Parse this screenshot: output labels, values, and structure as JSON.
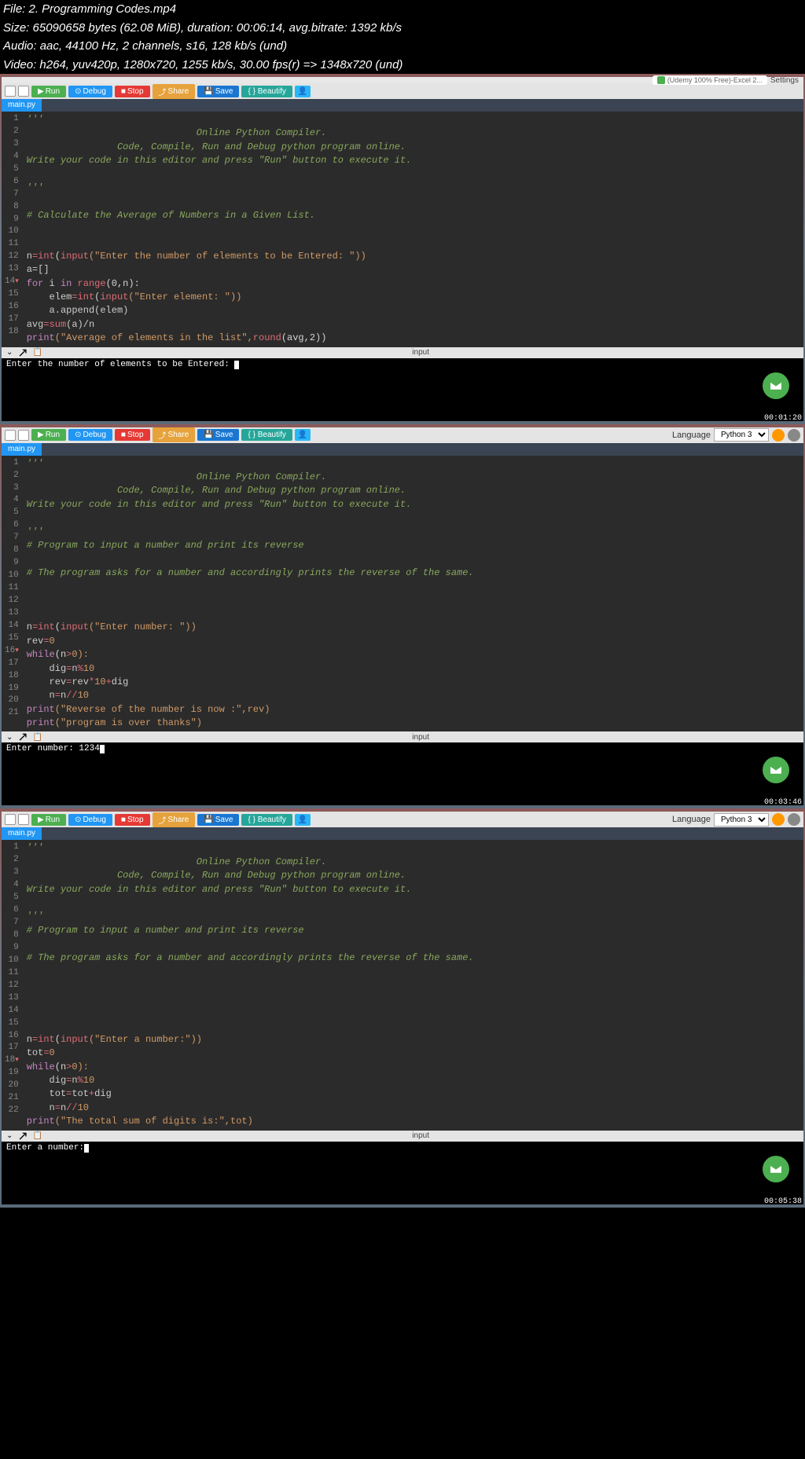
{
  "meta": {
    "file_line": "File: 2. Programming Codes.mp4",
    "size_line": "Size: 65090658 bytes (62.08 MiB), duration: 00:06:14, avg.bitrate: 1392 kb/s",
    "audio_line": "Audio: aac, 44100 Hz, 2 channels, s16, 128 kb/s (und)",
    "video_line": "Video: h264, yuv420p, 1280x720, 1255 kb/s, 30.00 fps(r) => 1348x720 (und)"
  },
  "browser": {
    "tab1": "(Udemy 100% Free)-Excel 2...",
    "settings": "Settings"
  },
  "toolbar": {
    "run": "Run",
    "debug": "Debug",
    "stop": "Stop",
    "share": "Share",
    "save": "Save",
    "beautify": "{ } Beautify"
  },
  "lang": {
    "label": "Language",
    "selected": "Python 3"
  },
  "tab_name": "main.py",
  "console": {
    "input_label": "input"
  },
  "shot1": {
    "lines": [
      "'''",
      "                              Online Python Compiler.",
      "                Code, Compile, Run and Debug python program online.",
      "Write your code in this editor and press \"Run\" button to execute it.",
      "",
      "'''",
      "",
      "# Calculate the Average of Numbers in a Given List."
    ],
    "code_l12_a": "n",
    "code_l12_b": "=",
    "code_l12_c": "int",
    "code_l12_d": "(",
    "code_l12_e": "input",
    "code_l12_f": "(\"Enter the number of elements to be Entered: \"))",
    "code_l13": "a=[]",
    "code_l14_a": "for",
    "code_l14_b": " i ",
    "code_l14_c": "in",
    "code_l14_d": " range",
    "code_l14_e": "(0,n):",
    "code_l15_a": "    elem",
    "code_l15_b": "=",
    "code_l15_c": "int",
    "code_l15_d": "(",
    "code_l15_e": "input",
    "code_l15_f": "(\"Enter element: \"))",
    "code_l16": "    a.append(elem)",
    "code_l17_a": "avg",
    "code_l17_b": "=",
    "code_l17_c": "sum",
    "code_l17_d": "(a)/n",
    "code_l18_a": "print",
    "code_l18_b": "(\"Average of elements in the list\",",
    "code_l18_c": "round",
    "code_l18_d": "(avg,2))",
    "console_text": "Enter the number of elements to be Entered: ",
    "timestamp": "00:01:20"
  },
  "shot2": {
    "lines": [
      "'''",
      "                              Online Python Compiler.",
      "                Code, Compile, Run and Debug python program online.",
      "Write your code in this editor and press \"Run\" button to execute it.",
      "",
      "'''",
      "# Program to input a number and print its reverse",
      "",
      "# The program asks for a number and accordingly prints the reverse of the same.",
      "",
      "",
      ""
    ],
    "code_l14_a": "n",
    "code_l14_b": "=",
    "code_l14_c": "int",
    "code_l14_d": "(",
    "code_l14_e": "input",
    "code_l14_f": "(\"Enter number: \"))",
    "code_l15": "rev=0",
    "code_l16_a": "while",
    "code_l16_b": "(n",
    "code_l16_c": ">",
    "code_l16_d": "0):",
    "code_l17_a": "    dig",
    "code_l17_b": "=",
    "code_l17_c": "n",
    "code_l17_d": "%",
    "code_l17_e": "10",
    "code_l18_a": "    rev",
    "code_l18_b": "=",
    "code_l18_c": "rev",
    "code_l18_d": "*",
    "code_l18_e": "10",
    "code_l18_f": "+",
    "code_l18_g": "dig",
    "code_l19_a": "    n",
    "code_l19_b": "=",
    "code_l19_c": "n",
    "code_l19_d": "//",
    "code_l19_e": "10",
    "code_l20_a": "print",
    "code_l20_b": "(\"Reverse of the number is now :\",rev)",
    "code_l21_a": "print",
    "code_l21_b": "(\"program is over thanks\")",
    "console_text": "Enter number: 1234",
    "timestamp": "00:03:46"
  },
  "shot3": {
    "lines": [
      "'''",
      "                              Online Python Compiler.",
      "                Code, Compile, Run and Debug python program online.",
      "Write your code in this editor and press \"Run\" button to execute it.",
      "",
      "'''",
      "# Program to input a number and print its reverse",
      "",
      "# The program asks for a number and accordingly prints the reverse of the same.",
      "",
      "",
      "",
      "",
      ""
    ],
    "code_l16_a": "n",
    "code_l16_b": "=",
    "code_l16_c": "int",
    "code_l16_d": "(",
    "code_l16_e": "input",
    "code_l16_f": "(\"Enter a number:\"))",
    "code_l17": "tot=0",
    "code_l18_a": "while",
    "code_l18_b": "(n",
    "code_l18_c": ">",
    "code_l18_d": "0):",
    "code_l19_a": "    dig",
    "code_l19_b": "=",
    "code_l19_c": "n",
    "code_l19_d": "%",
    "code_l19_e": "10",
    "code_l20_a": "    tot",
    "code_l20_b": "=",
    "code_l20_c": "tot",
    "code_l20_d": "+",
    "code_l20_e": "dig",
    "code_l21_a": "    n",
    "code_l21_b": "=",
    "code_l21_c": "n",
    "code_l21_d": "//",
    "code_l21_e": "10",
    "code_l22_a": "print",
    "code_l22_b": "(\"The total sum of digits is:\",tot)",
    "console_text": "Enter a number:",
    "timestamp": "00:05:38"
  }
}
